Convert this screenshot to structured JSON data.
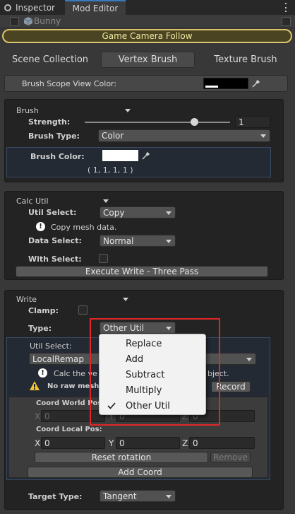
{
  "tabs": [
    {
      "label": "Inspector",
      "active": false
    },
    {
      "label": "Mod Editor",
      "active": true
    }
  ],
  "object": {
    "name": "Bunny"
  },
  "game_camera_button": "Game Camera Follow",
  "mode_tabs": [
    "Scene Collection",
    "Vertex Brush",
    "Texture Brush"
  ],
  "brush_scope_label": "Brush Scope View Color:",
  "brush": {
    "header": "Brush",
    "strength_label": "Strength:",
    "strength_value": "1",
    "strength_fraction": 0.75,
    "type_label": "Brush Type:",
    "type_value": "Color",
    "color_label": "Brush Color:",
    "color_rgba": "( 1, 1, 1, 1 )"
  },
  "calc_util": {
    "header": "Calc Util",
    "util_select_label": "Util Select:",
    "util_select_value": "Copy",
    "info_text": "Copy mesh data.",
    "data_select_label": "Data Select:",
    "data_select_value": "Normal",
    "with_select_label": "With Select:",
    "execute_button": "Execute Write - Three Pass"
  },
  "write": {
    "header": "Write",
    "clamp_label": "Clamp:",
    "type_label": "Type:",
    "type_value": "Other Util",
    "util_select_label": "Util Select:",
    "util_select_value": "LocalRemap",
    "calc_text_left": "Calc the ve",
    "calc_text_right": "bject.",
    "warning_text": "No raw mesh wa",
    "record_button": "Record",
    "coord_world_label": "Coord World Pos:",
    "coord_local_label": "Coord Local Pos:",
    "axis_x": "X",
    "axis_y": "Y",
    "axis_z": "Z",
    "world_x": "0",
    "world_y": "0",
    "world_z": "0",
    "local_x": "0",
    "local_y": "0",
    "local_z": "0",
    "reset_rotation_button": "Reset rotation",
    "remove_button": "Remove",
    "add_coord_button": "Add Coord",
    "target_type_label": "Target Type:",
    "target_type_value": "Tangent"
  },
  "type_menu": {
    "items": [
      {
        "label": "Replace",
        "checked": false
      },
      {
        "label": "Add",
        "checked": false
      },
      {
        "label": "Subtract",
        "checked": false
      },
      {
        "label": "Multiply",
        "checked": false
      },
      {
        "label": "Other Util",
        "checked": true
      }
    ]
  },
  "colors": {
    "highlight": "#e02626",
    "game_camera_border": "#d9c66a",
    "warning": "#f2c230",
    "brush_color": "#ffffff"
  }
}
